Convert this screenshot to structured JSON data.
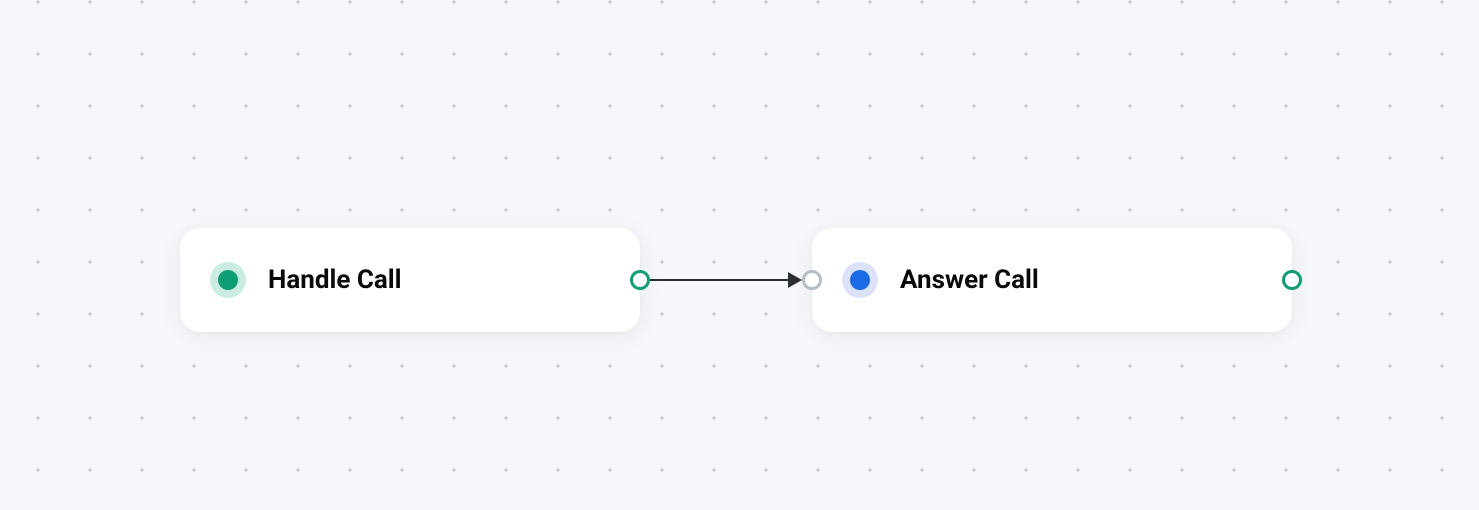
{
  "nodes": {
    "handle_call": {
      "label": "Handle Call",
      "indicator_color": "#0f9d76",
      "indicator_bg": "#c9ede3"
    },
    "answer_call": {
      "label": "Answer Call",
      "indicator_color": "#1a6ae5",
      "indicator_bg": "#dbe3fb"
    }
  },
  "colors": {
    "canvas_bg": "#f5f7fa",
    "dot": "#c0c7d0",
    "node_bg": "#ffffff",
    "text": "#0a0a0a",
    "port_output_border": "#0f9d76",
    "port_input_border": "#b5bcc4",
    "edge": "#2b2f33"
  }
}
